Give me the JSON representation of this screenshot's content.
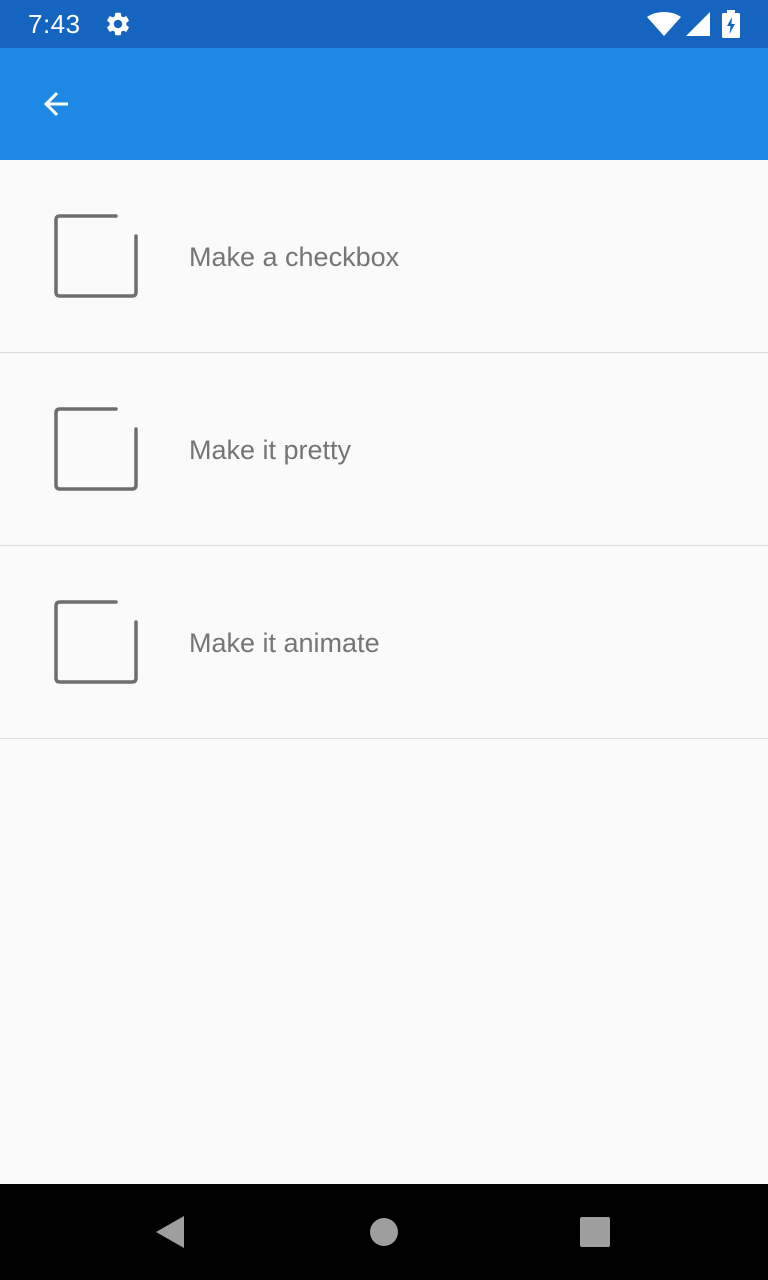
{
  "status_bar": {
    "time": "7:43",
    "icons": [
      "gear-icon",
      "wifi-icon",
      "signal-icon",
      "battery-charging-icon"
    ],
    "background_color": "#1565c0"
  },
  "app_bar": {
    "background_color": "#1e88e5",
    "back_icon": "arrow-back-icon"
  },
  "tasks": [
    {
      "label": "Make a checkbox",
      "checked": false
    },
    {
      "label": "Make it pretty",
      "checked": false
    },
    {
      "label": "Make it animate",
      "checked": false
    }
  ],
  "nav_bar": {
    "buttons": [
      "back-triangle-icon",
      "home-circle-icon",
      "recents-square-icon"
    ]
  },
  "colors": {
    "checkbox_stroke": "#6e6e6e",
    "label_text": "#757575",
    "divider": "#dcdcdc"
  }
}
